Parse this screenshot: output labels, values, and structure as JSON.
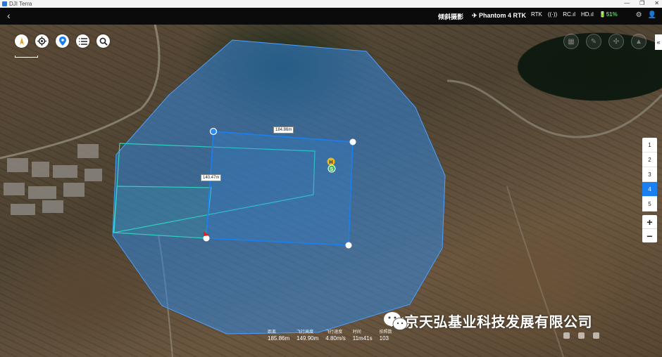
{
  "window": {
    "title": "DJI Terra",
    "controls": [
      "—",
      "❐",
      "✕"
    ]
  },
  "topbar": {
    "back": "‹",
    "mode": "倾斜摄影",
    "drone": "Phantom 4 RTK",
    "status_items": [
      "RTK",
      "((·))",
      "RC.ıl",
      "HD.ıl"
    ],
    "battery": "51%"
  },
  "map": {
    "width_label": "184.86m",
    "height_label": "140.47m",
    "home_marker": "H",
    "start_marker": "S"
  },
  "layers": [
    "1",
    "2",
    "3",
    "4",
    "5"
  ],
  "active_layer": "4",
  "zoom": {
    "in": "+",
    "out": "−"
  },
  "collapse": "«",
  "stats": [
    {
      "label": "距离",
      "value": "185.86m"
    },
    {
      "label": "飞行高度",
      "value": "149.90m"
    },
    {
      "label": "飞行速度",
      "value": "4.80m/s"
    },
    {
      "label": "时间",
      "value": "11m41s"
    },
    {
      "label": "拍照数",
      "value": "103"
    }
  ],
  "watermark": "北京天弘基业科技发展有限公司",
  "colors": {
    "accent": "#1a7ff0",
    "area_fill": "#2f86e0",
    "overlap": "#2fd0c0"
  }
}
